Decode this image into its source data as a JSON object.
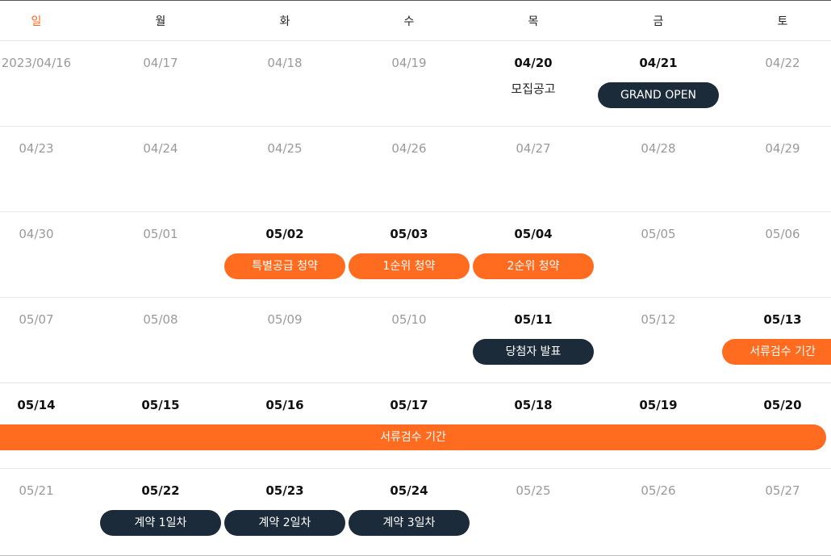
{
  "weekdays": [
    "일",
    "월",
    "화",
    "수",
    "목",
    "금",
    "토"
  ],
  "weeks": [
    {
      "dates": [
        "2023/04/16",
        "04/17",
        "04/18",
        "04/19",
        "04/20",
        "04/21",
        "04/22"
      ],
      "note": "모집공고",
      "events": [
        "GRAND OPEN"
      ]
    },
    {
      "dates": [
        "04/23",
        "04/24",
        "04/25",
        "04/26",
        "04/27",
        "04/28",
        "04/29"
      ]
    },
    {
      "dates": [
        "04/30",
        "05/01",
        "05/02",
        "05/03",
        "05/04",
        "05/05",
        "05/06"
      ],
      "events": [
        "특별공급 청약",
        "1순위 청약",
        "2순위 청약"
      ]
    },
    {
      "dates": [
        "05/07",
        "05/08",
        "05/09",
        "05/10",
        "05/11",
        "05/12",
        "05/13"
      ],
      "events": [
        "당첨자 발표",
        "서류검수 기간"
      ]
    },
    {
      "dates": [
        "05/14",
        "05/15",
        "05/16",
        "05/17",
        "05/18",
        "05/19",
        "05/20"
      ],
      "events": [
        "서류검수 기간"
      ]
    },
    {
      "dates": [
        "05/21",
        "05/22",
        "05/23",
        "05/24",
        "05/25",
        "05/26",
        "05/27"
      ],
      "events": [
        "계약 1일차",
        "계약 2일차",
        "계약 3일차"
      ]
    }
  ],
  "colors": {
    "accent_orange": "#ff6b1f",
    "sunday_orange": "#f26b21",
    "dark_navy": "#1c2b3a",
    "inactive_gray": "#9a9a9a"
  }
}
